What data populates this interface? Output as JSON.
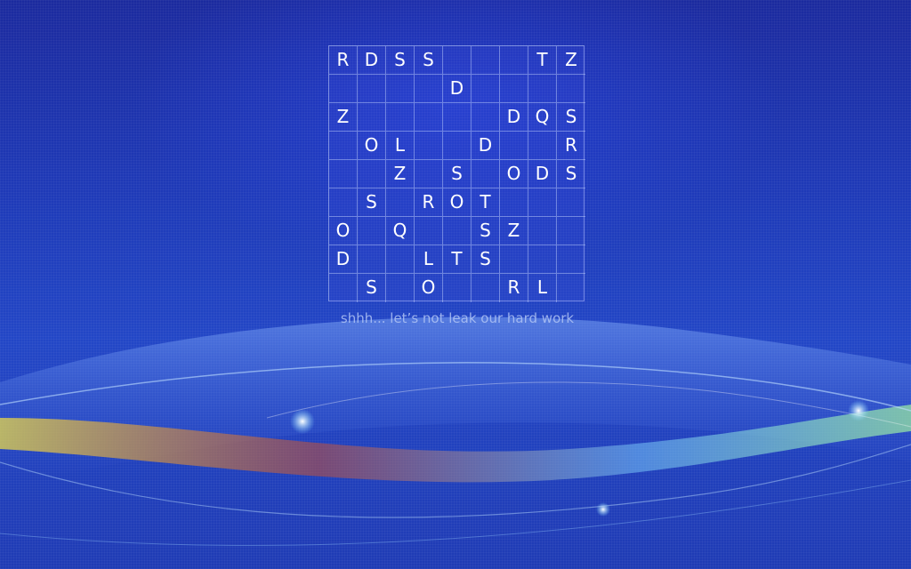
{
  "desktop": {
    "puzzle": {
      "rows": [
        [
          "R",
          "D",
          "S",
          "S",
          "",
          "",
          "",
          "T",
          "Z"
        ],
        [
          "",
          "",
          "",
          "",
          "D",
          "",
          "",
          "",
          ""
        ],
        [
          "Z",
          "",
          "",
          "",
          "",
          "",
          "D",
          "Q",
          "S"
        ],
        [
          "",
          "O",
          "L",
          "",
          "",
          "D",
          "",
          "",
          "R"
        ],
        [
          "",
          "",
          "Z",
          "",
          "S",
          "",
          "O",
          "D",
          "S"
        ],
        [
          "",
          "S",
          "",
          "R",
          "O",
          "T",
          "",
          "",
          ""
        ],
        [
          "O",
          "",
          "Q",
          "",
          "",
          "S",
          "Z",
          "",
          ""
        ],
        [
          "D",
          "",
          "",
          "L",
          "T",
          "S",
          "",
          "",
          ""
        ],
        [
          "",
          "S",
          "",
          "O",
          "",
          "",
          "R",
          "L",
          ""
        ]
      ]
    },
    "tagline": "shhh... let’s not leak our hard work",
    "colors": {
      "background": "#1e3ab8",
      "grid_line": "#c8d7ff",
      "letter": "#ffffff"
    }
  }
}
